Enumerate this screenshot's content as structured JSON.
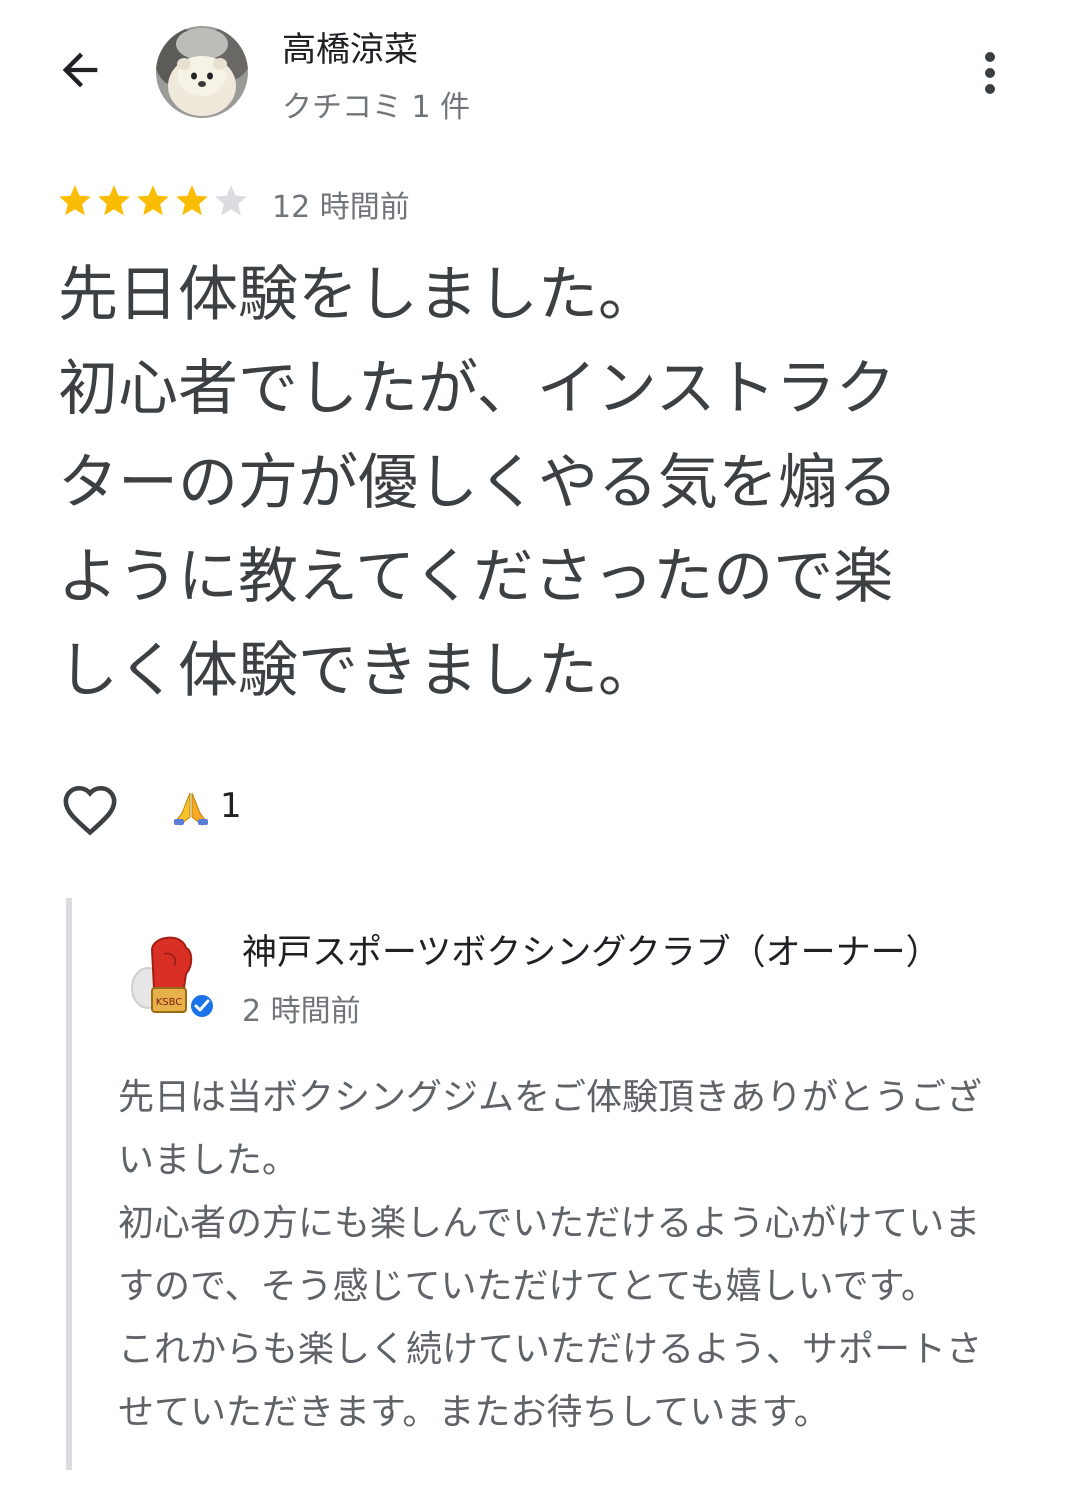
{
  "header": {
    "reviewer_name": "高橋涼菜",
    "review_count": "クチコミ 1 件",
    "back_icon": "arrow-left-icon",
    "more_icon": "more-vert-icon"
  },
  "review": {
    "rating": 4,
    "rating_max": 5,
    "time": "12 時間前",
    "text": "先日体験をしました。\n初心者でしたが、インストラク\nターの方が優しくやる気を煽る\nように教えてくださったので楽\nしく体験できました。",
    "reaction_icon": "folded-hands-icon",
    "reaction_count": "1"
  },
  "owner_reply": {
    "name": "神戸スポーツボクシングクラブ（オーナー）",
    "logo_text": "KSBC",
    "time": "2 時間前",
    "text": "先日は当ボクシングジムをご体験頂きありがとうござ\nいました。\n初心者の方にも楽しんでいただけるよう心がけていま\nすので、そう感じていただけてとても嬉しいです。\nこれからも楽しく続けていただけるよう、サポートさ\nせていただきます。またお待ちしています。"
  },
  "colors": {
    "star_filled": "#fbbc04",
    "star_empty": "#dadce0",
    "verified": "#1a73e8",
    "glove": "#d93025"
  }
}
